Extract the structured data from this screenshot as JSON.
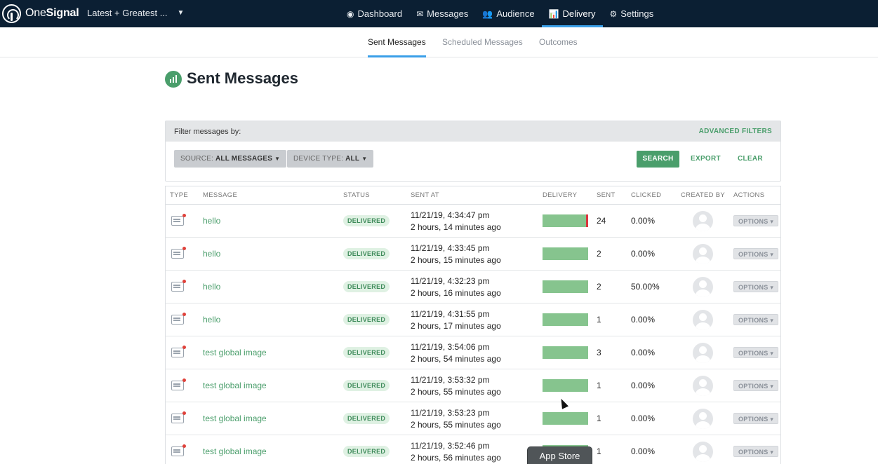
{
  "brand": {
    "name_light": "One",
    "name_bold": "Signal"
  },
  "app_selector": {
    "value": "Latest + Greatest ..."
  },
  "nav": {
    "items": [
      {
        "label": "Dashboard",
        "icon": "dashboard-icon",
        "glyph": "◉"
      },
      {
        "label": "Messages",
        "icon": "messages-icon",
        "glyph": "✉"
      },
      {
        "label": "Audience",
        "icon": "audience-icon",
        "glyph": "👥"
      },
      {
        "label": "Delivery",
        "icon": "delivery-icon",
        "glyph": "📊"
      },
      {
        "label": "Settings",
        "icon": "gear-icon",
        "glyph": "⚙"
      }
    ],
    "active": "Delivery"
  },
  "subnav": {
    "tabs": [
      "Sent Messages",
      "Scheduled Messages",
      "Outcomes"
    ],
    "active": "Sent Messages"
  },
  "page": {
    "title": "Sent Messages"
  },
  "filters": {
    "title": "Filter messages by:",
    "advanced": "ADVANCED FILTERS",
    "source_label": "SOURCE:",
    "source_value": "ALL MESSAGES",
    "device_label": "DEVICE TYPE:",
    "device_value": "ALL",
    "search": "SEARCH",
    "export": "EXPORT",
    "clear": "CLEAR"
  },
  "table": {
    "columns": [
      "TYPE",
      "MESSAGE",
      "STATUS",
      "SENT AT",
      "DELIVERY",
      "SENT",
      "CLICKED",
      "CREATED BY",
      "ACTIONS"
    ],
    "rows": [
      {
        "message": "hello",
        "status": "DELIVERED",
        "sent_at": "11/21/19, 4:34:47 pm",
        "ago": "2 hours, 14 minutes ago",
        "sent": "24",
        "clicked": "0.00%",
        "failed": true,
        "options": "OPTIONS"
      },
      {
        "message": "hello",
        "status": "DELIVERED",
        "sent_at": "11/21/19, 4:33:45 pm",
        "ago": "2 hours, 15 minutes ago",
        "sent": "2",
        "clicked": "0.00%",
        "failed": false,
        "options": "OPTIONS"
      },
      {
        "message": "hello",
        "status": "DELIVERED",
        "sent_at": "11/21/19, 4:32:23 pm",
        "ago": "2 hours, 16 minutes ago",
        "sent": "2",
        "clicked": "50.00%",
        "failed": false,
        "options": "OPTIONS"
      },
      {
        "message": "hello",
        "status": "DELIVERED",
        "sent_at": "11/21/19, 4:31:55 pm",
        "ago": "2 hours, 17 minutes ago",
        "sent": "1",
        "clicked": "0.00%",
        "failed": false,
        "options": "OPTIONS"
      },
      {
        "message": "test global image",
        "status": "DELIVERED",
        "sent_at": "11/21/19, 3:54:06 pm",
        "ago": "2 hours, 54 minutes ago",
        "sent": "3",
        "clicked": "0.00%",
        "failed": false,
        "options": "OPTIONS"
      },
      {
        "message": "test global image",
        "status": "DELIVERED",
        "sent_at": "11/21/19, 3:53:32 pm",
        "ago": "2 hours, 55 minutes ago",
        "sent": "1",
        "clicked": "0.00%",
        "failed": false,
        "options": "OPTIONS"
      },
      {
        "message": "test global image",
        "status": "DELIVERED",
        "sent_at": "11/21/19, 3:53:23 pm",
        "ago": "2 hours, 55 minutes ago",
        "sent": "1",
        "clicked": "0.00%",
        "failed": false,
        "options": "OPTIONS"
      },
      {
        "message": "test global image",
        "status": "DELIVERED",
        "sent_at": "11/21/19, 3:52:46 pm",
        "ago": "2 hours, 56 minutes ago",
        "sent": "1",
        "clicked": "0.00%",
        "failed": false,
        "options": "OPTIONS"
      }
    ]
  },
  "tooltip": {
    "text": "App Store"
  },
  "colors": {
    "nav_bg": "#0b1f33",
    "accent": "#4a9e6b",
    "active_tab": "#3a9fe8",
    "delivered_bar": "#86c48e",
    "failed": "#d9363e"
  }
}
